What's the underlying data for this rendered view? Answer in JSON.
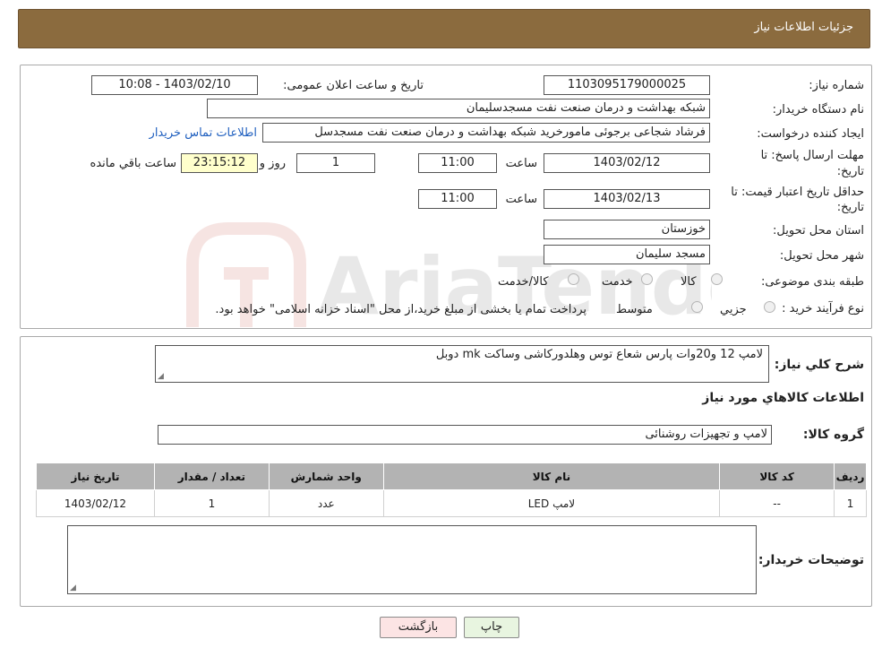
{
  "header": {
    "title": "جزئیات اطلاعات نیاز"
  },
  "form": {
    "need_number_label": "شماره نیاز:",
    "need_number": "1103095179000025",
    "announce_label": "تاریخ و ساعت اعلان عمومی:",
    "announce_value": "1403/02/10 - 10:08",
    "buyer_label": "نام دستگاه خریدار:",
    "buyer_value": "شبکه بهداشت و درمان صنعت نفت مسجدسلیمان",
    "creator_label": "ایجاد کننده درخواست:",
    "creator_value": "فرشاد شجاعی برجوئی مامورخرید شبکه بهداشت و درمان صنعت نفت مسجدسل",
    "contact_link": "اطلاعات تماس خریدار",
    "deadline_label_1": "مهلت ارسال پاسخ: تا",
    "deadline_label_2": "تاریخ:",
    "deadline_date": "1403/02/12",
    "time_label": "ساعت",
    "deadline_time": "11:00",
    "days_value": "1",
    "days_label": "روز و",
    "remaining_value": "23:15:12",
    "remaining_label": "ساعت باقي مانده",
    "validity_label_1": "حداقل تاریخ اعتبار قیمت: تا",
    "validity_label_2": "تاریخ:",
    "validity_date": "1403/02/13",
    "validity_time": "11:00",
    "province_label": "استان محل تحویل:",
    "province_value": "خوزستان",
    "city_label": "شهر محل تحویل:",
    "city_value": "مسجد سلیمان",
    "category_label": "طبقه بندی موضوعی:",
    "category_options": [
      "کالا",
      "خدمت",
      "کالا/خدمت"
    ],
    "process_label": "نوع فرآیند خرید :",
    "process_options": [
      "جزيي",
      "متوسط"
    ],
    "process_note": "پرداخت تمام یا بخشی از مبلغ خرید،از محل \"اسناد خزانه اسلامی\" خواهد بود."
  },
  "details": {
    "summary_label": "شرح کلي نياز:",
    "summary_value": "لامپ 12 و20وات پارس شعاع توس وهلدورکاشی وساکت mk دوبل",
    "goods_info_title": "اطلاعات کالاهاي مورد نياز",
    "goods_group_label": "گروه کالا:",
    "goods_group_value": "لامپ و تجهیزات روشنائی",
    "table_headers": [
      "ردیف",
      "کد کالا",
      "نام کالا",
      "واحد شمارش",
      "تعداد / مقدار",
      "تاریخ نیاز"
    ],
    "table_rows": [
      [
        "1",
        "--",
        "لامپ LED",
        "عدد",
        "1",
        "1403/02/12"
      ]
    ],
    "buyer_notes_label": "توضیحات خریدار:"
  },
  "buttons": {
    "print": "چاپ",
    "back": "بازگشت"
  },
  "colors": {
    "header": "#8b6b3e",
    "link": "#1f5fbf",
    "remaining_bg": "#ffffcc",
    "print_bg": "#e8f5e0",
    "back_bg": "#fce4e4"
  }
}
